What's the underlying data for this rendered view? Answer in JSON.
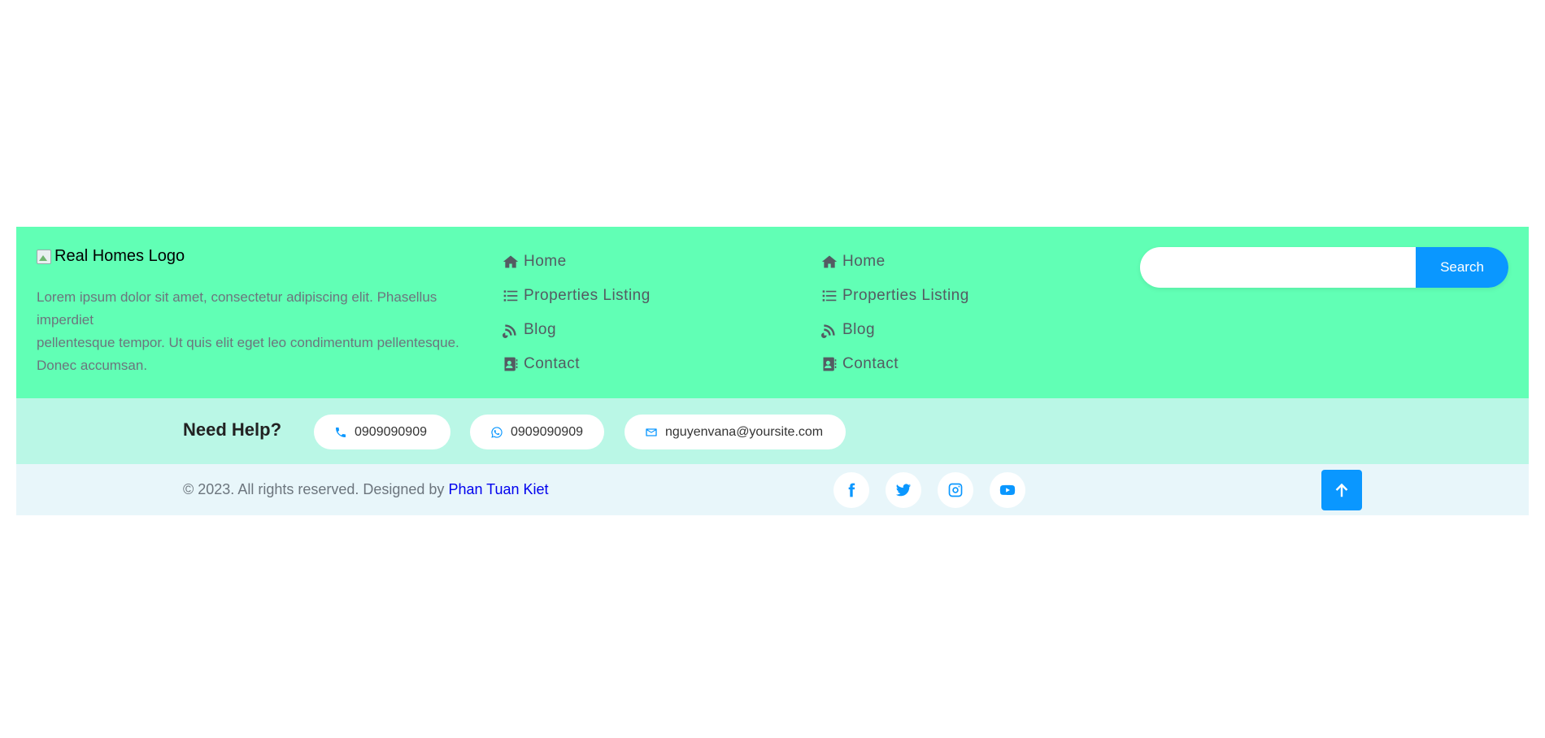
{
  "footer": {
    "logo_alt": "Real Homes Logo",
    "description": [
      "Lorem ipsum dolor sit amet, consectetur adipiscing elit. Phasellus imperdiet",
      "pellentesque tempor. Ut quis elit eget leo condimentum pellentesque. Donec accumsan."
    ],
    "nav_col1": [
      {
        "label": "Home",
        "icon": "home-icon"
      },
      {
        "label": "Properties Listing",
        "icon": "list-icon"
      },
      {
        "label": "Blog",
        "icon": "blog-icon"
      },
      {
        "label": "Contact",
        "icon": "contact-book-icon"
      }
    ],
    "nav_col2": [
      {
        "label": "Home",
        "icon": "home-icon"
      },
      {
        "label": "Properties Listing",
        "icon": "list-icon"
      },
      {
        "label": "Blog",
        "icon": "blog-icon"
      },
      {
        "label": "Contact",
        "icon": "contact-book-icon"
      }
    ],
    "search": {
      "placeholder": "",
      "value": "",
      "button_label": "Search"
    },
    "help": {
      "title": "Need Help?",
      "phone": "0909090909",
      "whatsapp": "0909090909",
      "email": "nguyenvana@yoursite.com"
    },
    "copyright": {
      "text": "© 2023. All rights reserved. Designed by ",
      "designer": "Phan Tuan Kiet"
    },
    "social": [
      "facebook-icon",
      "twitter-icon",
      "instagram-icon",
      "youtube-icon"
    ]
  },
  "colors": {
    "footer_top_bg": "#61ffb5",
    "help_bar_bg": "#baf7e6",
    "copyright_bar_bg": "#e8f6fa",
    "accent": "#0a97ff",
    "nav_text": "#545b62",
    "muted_text": "#6c757d",
    "link": "#0000ee"
  }
}
